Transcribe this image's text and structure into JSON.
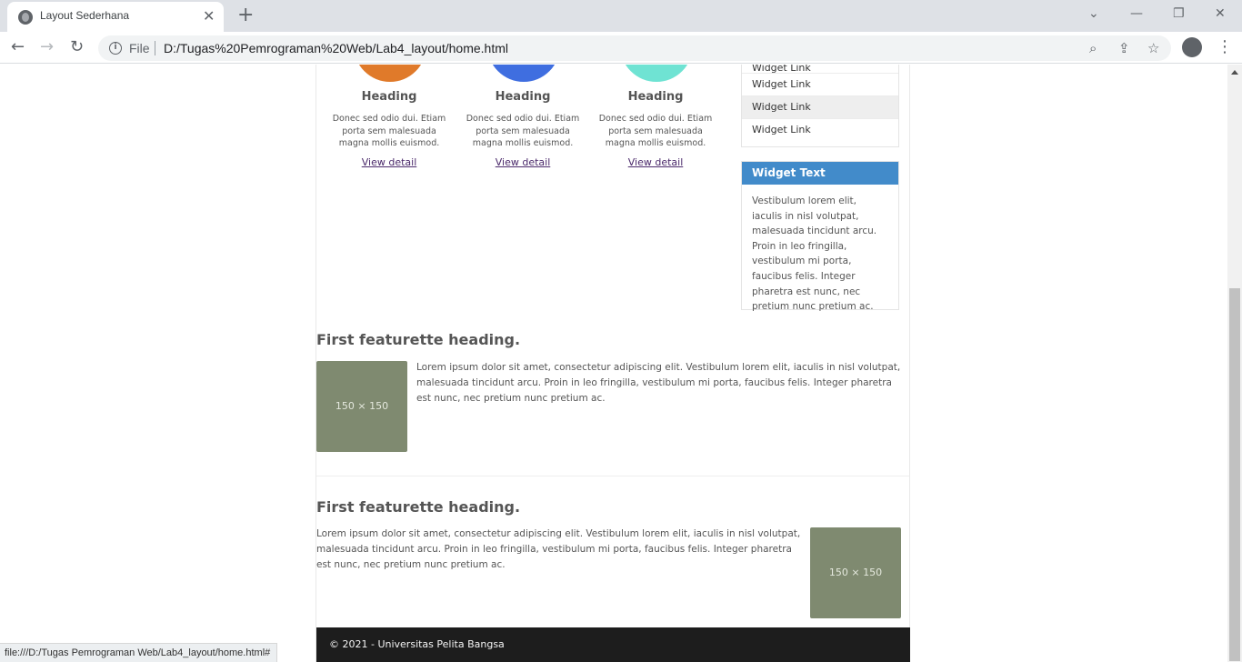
{
  "browser": {
    "tab_title": "Layout Sederhana",
    "tab_close": "✕",
    "new_tab": "+",
    "url_label": "File",
    "url": "D:/Tugas%20Pemrograman%20Web/Lab4_layout/home.html",
    "status_url": "file:///D:/Tugas Pemrograman Web/Lab4_layout/home.html#"
  },
  "columns": [
    {
      "title": "Heading",
      "text": "Donec sed odio dui. Etiam porta sem malesuada magna mollis euismod.",
      "link": "View detail",
      "color": "#e07a2a"
    },
    {
      "title": "Heading",
      "text": "Donec sed odio dui. Etiam porta sem malesuada magna mollis euismod.",
      "link": "View detail",
      "color": "#3f6ee0"
    },
    {
      "title": "Heading",
      "text": "Donec sed odio dui. Etiam porta sem malesuada magna mollis euismod.",
      "link": "View detail",
      "color": "#6fe3d3"
    }
  ],
  "widget_links": [
    "Widget Link",
    "Widget Link",
    "Widget Link",
    "Widget Link"
  ],
  "widget_text": {
    "title": "Widget Text",
    "body": "Vestibulum lorem elit, iaculis in nisl volutpat, malesuada tincidunt arcu. Proin in leo fringilla, vestibulum mi porta, faucibus felis. Integer pharetra est nunc, nec pretium nunc pretium ac."
  },
  "featurettes": [
    {
      "heading": "First featurette heading.",
      "image_label": "150 × 150",
      "text": "Lorem ipsum dolor sit amet, consectetur adipiscing elit. Vestibulum lorem elit, iaculis in nisl volutpat, malesuada tincidunt arcu. Proin in leo fringilla, vestibulum mi porta, faucibus felis. Integer pharetra est nunc, nec pretium nunc pretium ac."
    },
    {
      "heading": "First featurette heading.",
      "image_label": "150 × 150",
      "text": "Lorem ipsum dolor sit amet, consectetur adipiscing elit. Vestibulum lorem elit, iaculis in nisl volutpat, malesuada tincidunt arcu. Proin in leo fringilla, vestibulum mi porta, faucibus felis. Integer pharetra est nunc, nec pretium nunc pretium ac."
    }
  ],
  "footer": "© 2021 - Universitas Pelita Bangsa"
}
